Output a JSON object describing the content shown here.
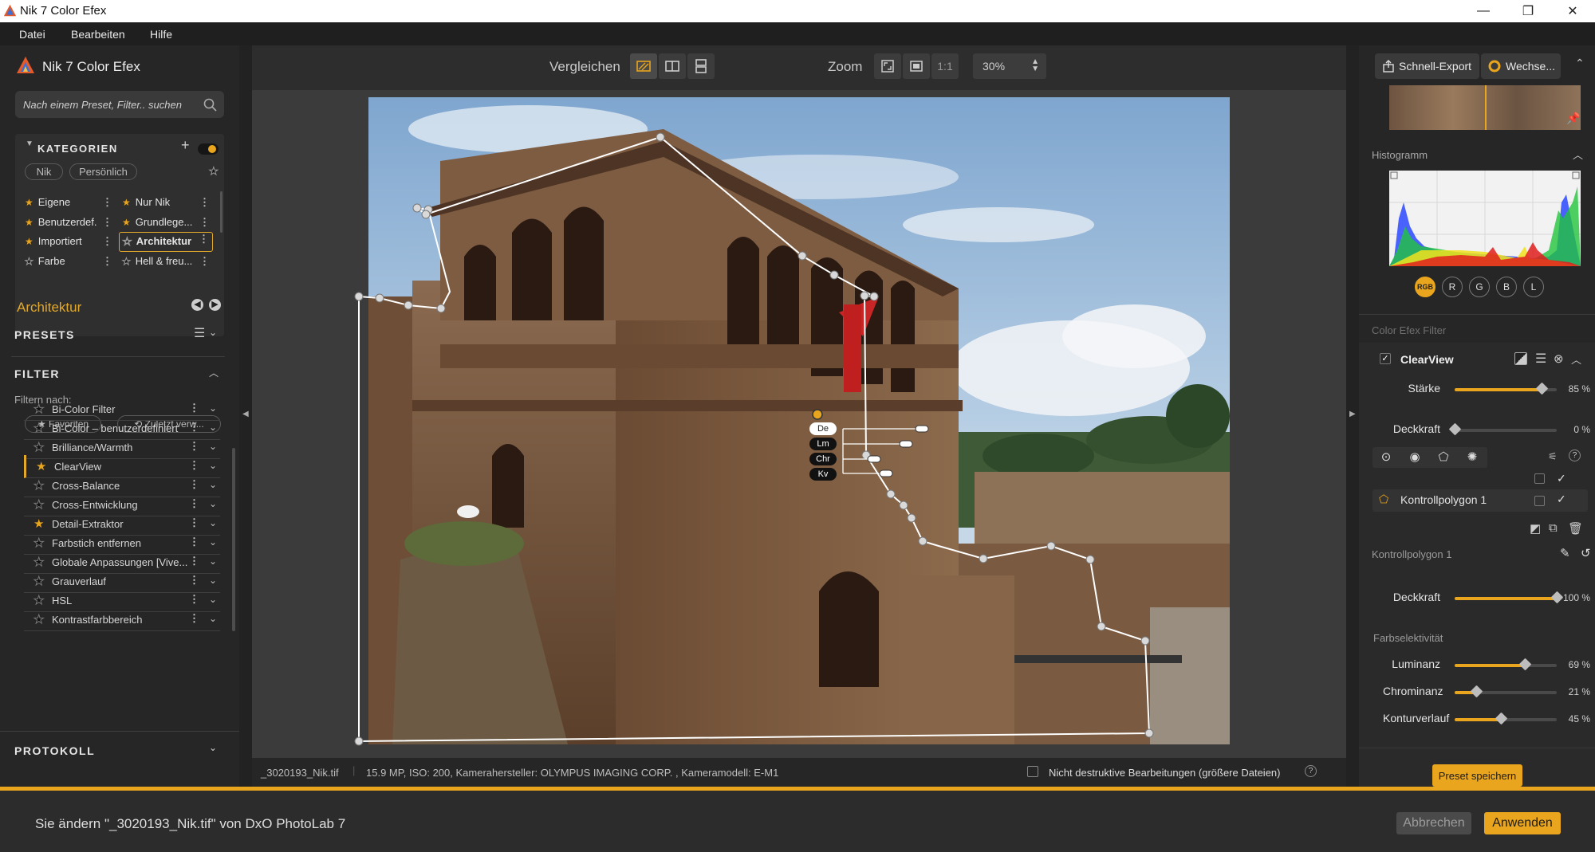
{
  "window": {
    "title": "Nik 7 Color Efex",
    "controls": [
      "minimize-icon",
      "maximize-icon",
      "close-icon"
    ]
  },
  "menu": {
    "items": [
      "Datei",
      "Bearbeiten",
      "Hilfe"
    ]
  },
  "left": {
    "app_name": "Nik 7 Color Efex",
    "search_placeholder": "Nach einem Preset, Filter.. suchen",
    "categories_title": "KATEGORIEN",
    "chips": [
      "Nik",
      "Persönlich"
    ],
    "categories": [
      [
        "Eigene",
        "Nur Nik"
      ],
      [
        "Benutzerdef.",
        "Grundlege..."
      ],
      [
        "Importiert",
        "Architektur"
      ],
      [
        "Farbe",
        "Hell & freu..."
      ]
    ],
    "selected_category": "Architektur",
    "current_category": "Architektur",
    "presets_title": "PRESETS",
    "filter_title": "FILTER",
    "filter_by": "Filtern nach:",
    "filter_chips": [
      "Favoriten",
      "Zuletzt verw..."
    ],
    "filters": [
      {
        "name": "Bi-Color Filter",
        "fav": false
      },
      {
        "name": "Bi-Color – benutzerdefiniert",
        "fav": false
      },
      {
        "name": "Brilliance/Warmth",
        "fav": false
      },
      {
        "name": "ClearView",
        "fav": true,
        "selected": true
      },
      {
        "name": "Cross-Balance",
        "fav": false
      },
      {
        "name": "Cross-Entwicklung",
        "fav": false
      },
      {
        "name": "Detail-Extraktor",
        "fav": true
      },
      {
        "name": "Farbstich entfernen",
        "fav": false
      },
      {
        "name": "Globale Anpassungen [Vive...",
        "fav": false
      },
      {
        "name": "Grauverlauf",
        "fav": false
      },
      {
        "name": "HSL",
        "fav": false
      },
      {
        "name": "Kontrastfarbbereich",
        "fav": false
      }
    ],
    "protocol_title": "PROTOKOLL"
  },
  "toolbar": {
    "compare_label": "Vergleichen",
    "zoom_label": "Zoom",
    "zoom_one": "1:1",
    "zoom_value": "30%"
  },
  "point_labels": [
    "De",
    "Lm",
    "Chr",
    "Kv"
  ],
  "status": {
    "filename": "_3020193_Nik.tif",
    "info": "15.9 MP, ISO: 200, Kamerahersteller: OLYMPUS IMAGING CORP.  , Kameramodell: E-M1",
    "nondestructive": "Nicht destruktive Bearbeitungen (größere Dateien)"
  },
  "right": {
    "export_label": "Schnell-Export",
    "switch_label": "Wechse...",
    "histogram_title": "Histogramm",
    "channels": [
      "RGB",
      "R",
      "G",
      "B",
      "L"
    ],
    "filters_title": "Color Efex Filter",
    "filter_name": "ClearView",
    "sliders": [
      {
        "label": "Stärke",
        "value": 85,
        "text": "85 %"
      },
      {
        "label": "Deckkraft",
        "value": 0,
        "text": "0 %"
      }
    ],
    "polygon_name": "Kontrollpolygon 1",
    "polygon_section": "Kontrollpolygon 1",
    "poly_opacity": {
      "label": "Deckkraft",
      "value": 100,
      "text": "100 %"
    },
    "color_sel_title": "Farbselektivität",
    "color_sliders": [
      {
        "label": "Luminanz",
        "value": 69,
        "text": "69 %"
      },
      {
        "label": "Chrominanz",
        "value": 21,
        "text": "21 %"
      },
      {
        "label": "Konturverlauf",
        "value": 45,
        "text": "45 %"
      }
    ],
    "save_preset": "Preset speichern"
  },
  "bottom": {
    "message": "Sie ändern \"_3020193_Nik.tif\" von DxO PhotoLab 7",
    "cancel": "Abbrechen",
    "apply": "Anwenden"
  },
  "colors": {
    "accent": "#e8a51d",
    "panel": "#262626",
    "canvas": "#3b3b3b"
  }
}
